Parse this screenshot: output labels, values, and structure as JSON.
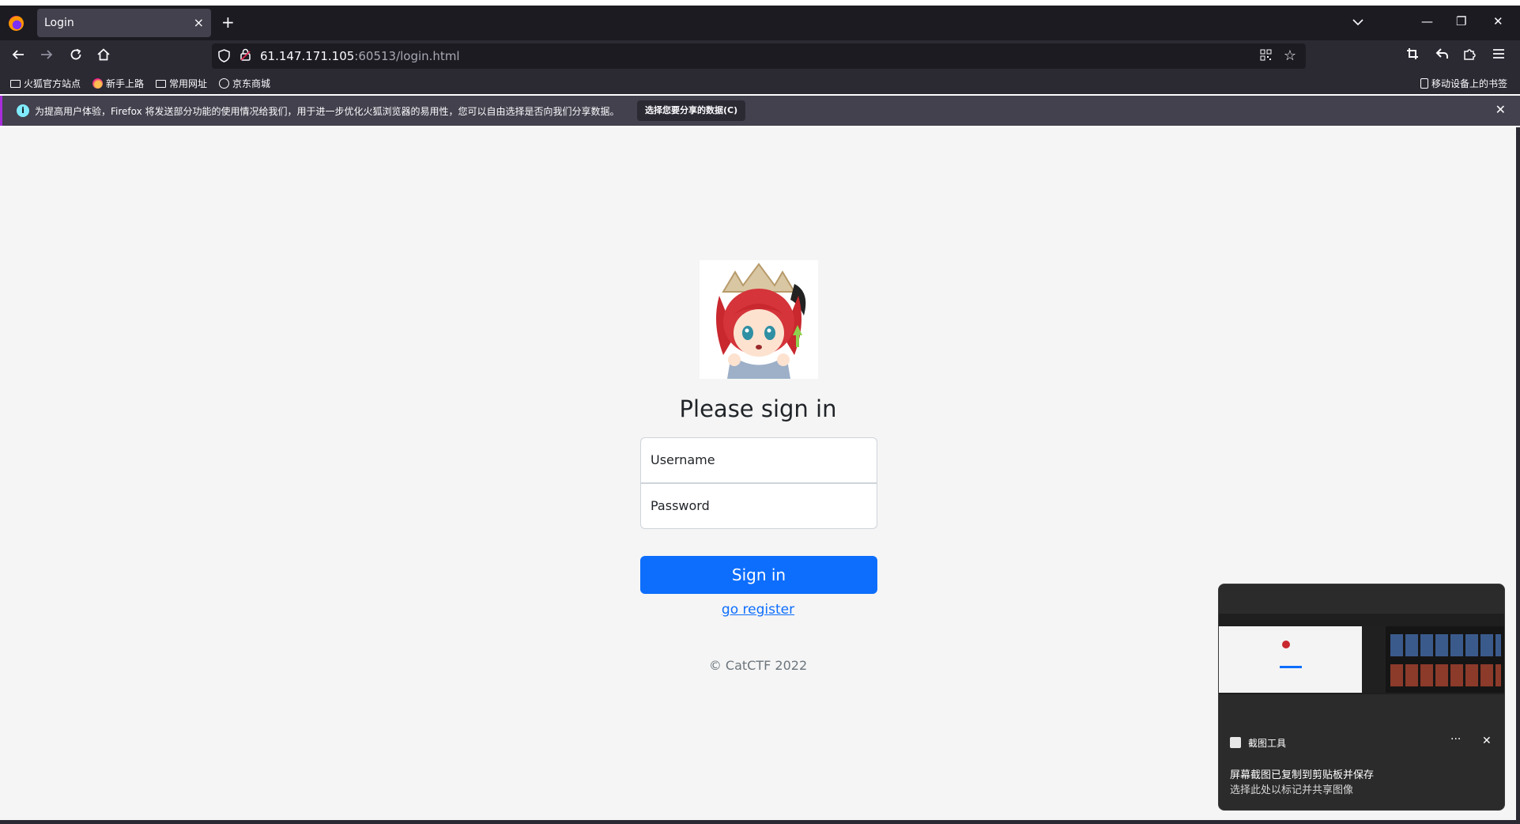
{
  "browser": {
    "tab": {
      "title": "Login",
      "close": "×"
    },
    "new_tab": "+",
    "url": {
      "host": "61.147.171.105",
      "port_path": ":60513/login.html"
    },
    "window_controls": {
      "minimize": "—",
      "restore": "❐",
      "close": "✕"
    },
    "bookmarks": [
      {
        "label": "火狐官方站点",
        "icon": "folder-icon"
      },
      {
        "label": "新手上路",
        "icon": "firefox-icon"
      },
      {
        "label": "常用网址",
        "icon": "folder-icon"
      },
      {
        "label": "京东商城",
        "icon": "globe-icon"
      }
    ],
    "mobile_bookmarks": "移动设备上的书签",
    "notification": {
      "text": "为提高用户体验，Firefox 将发送部分功能的使用情况给我们，用于进一步优化火狐浏览器的易用性，您可以自由选择是否向我们分享数据。",
      "button": "选择您要分享的数据(C)",
      "close": "✕"
    }
  },
  "page": {
    "heading": "Please sign in",
    "username_placeholder": "Username",
    "password_placeholder": "Password",
    "signin_label": "Sign in",
    "register_link": "go register",
    "copyright": "© CatCTF 2022"
  },
  "toast": {
    "app_name": "截图工具",
    "more": "···",
    "close": "✕",
    "line1": "屏幕截图已复制到剪贴板并保存",
    "line2": "选择此处以标记并共享图像"
  },
  "colors": {
    "accent": "#0d6efd",
    "tabbar": "#1c1b22",
    "toolbar": "#2b2a33",
    "page_bg": "#f5f5f5"
  }
}
